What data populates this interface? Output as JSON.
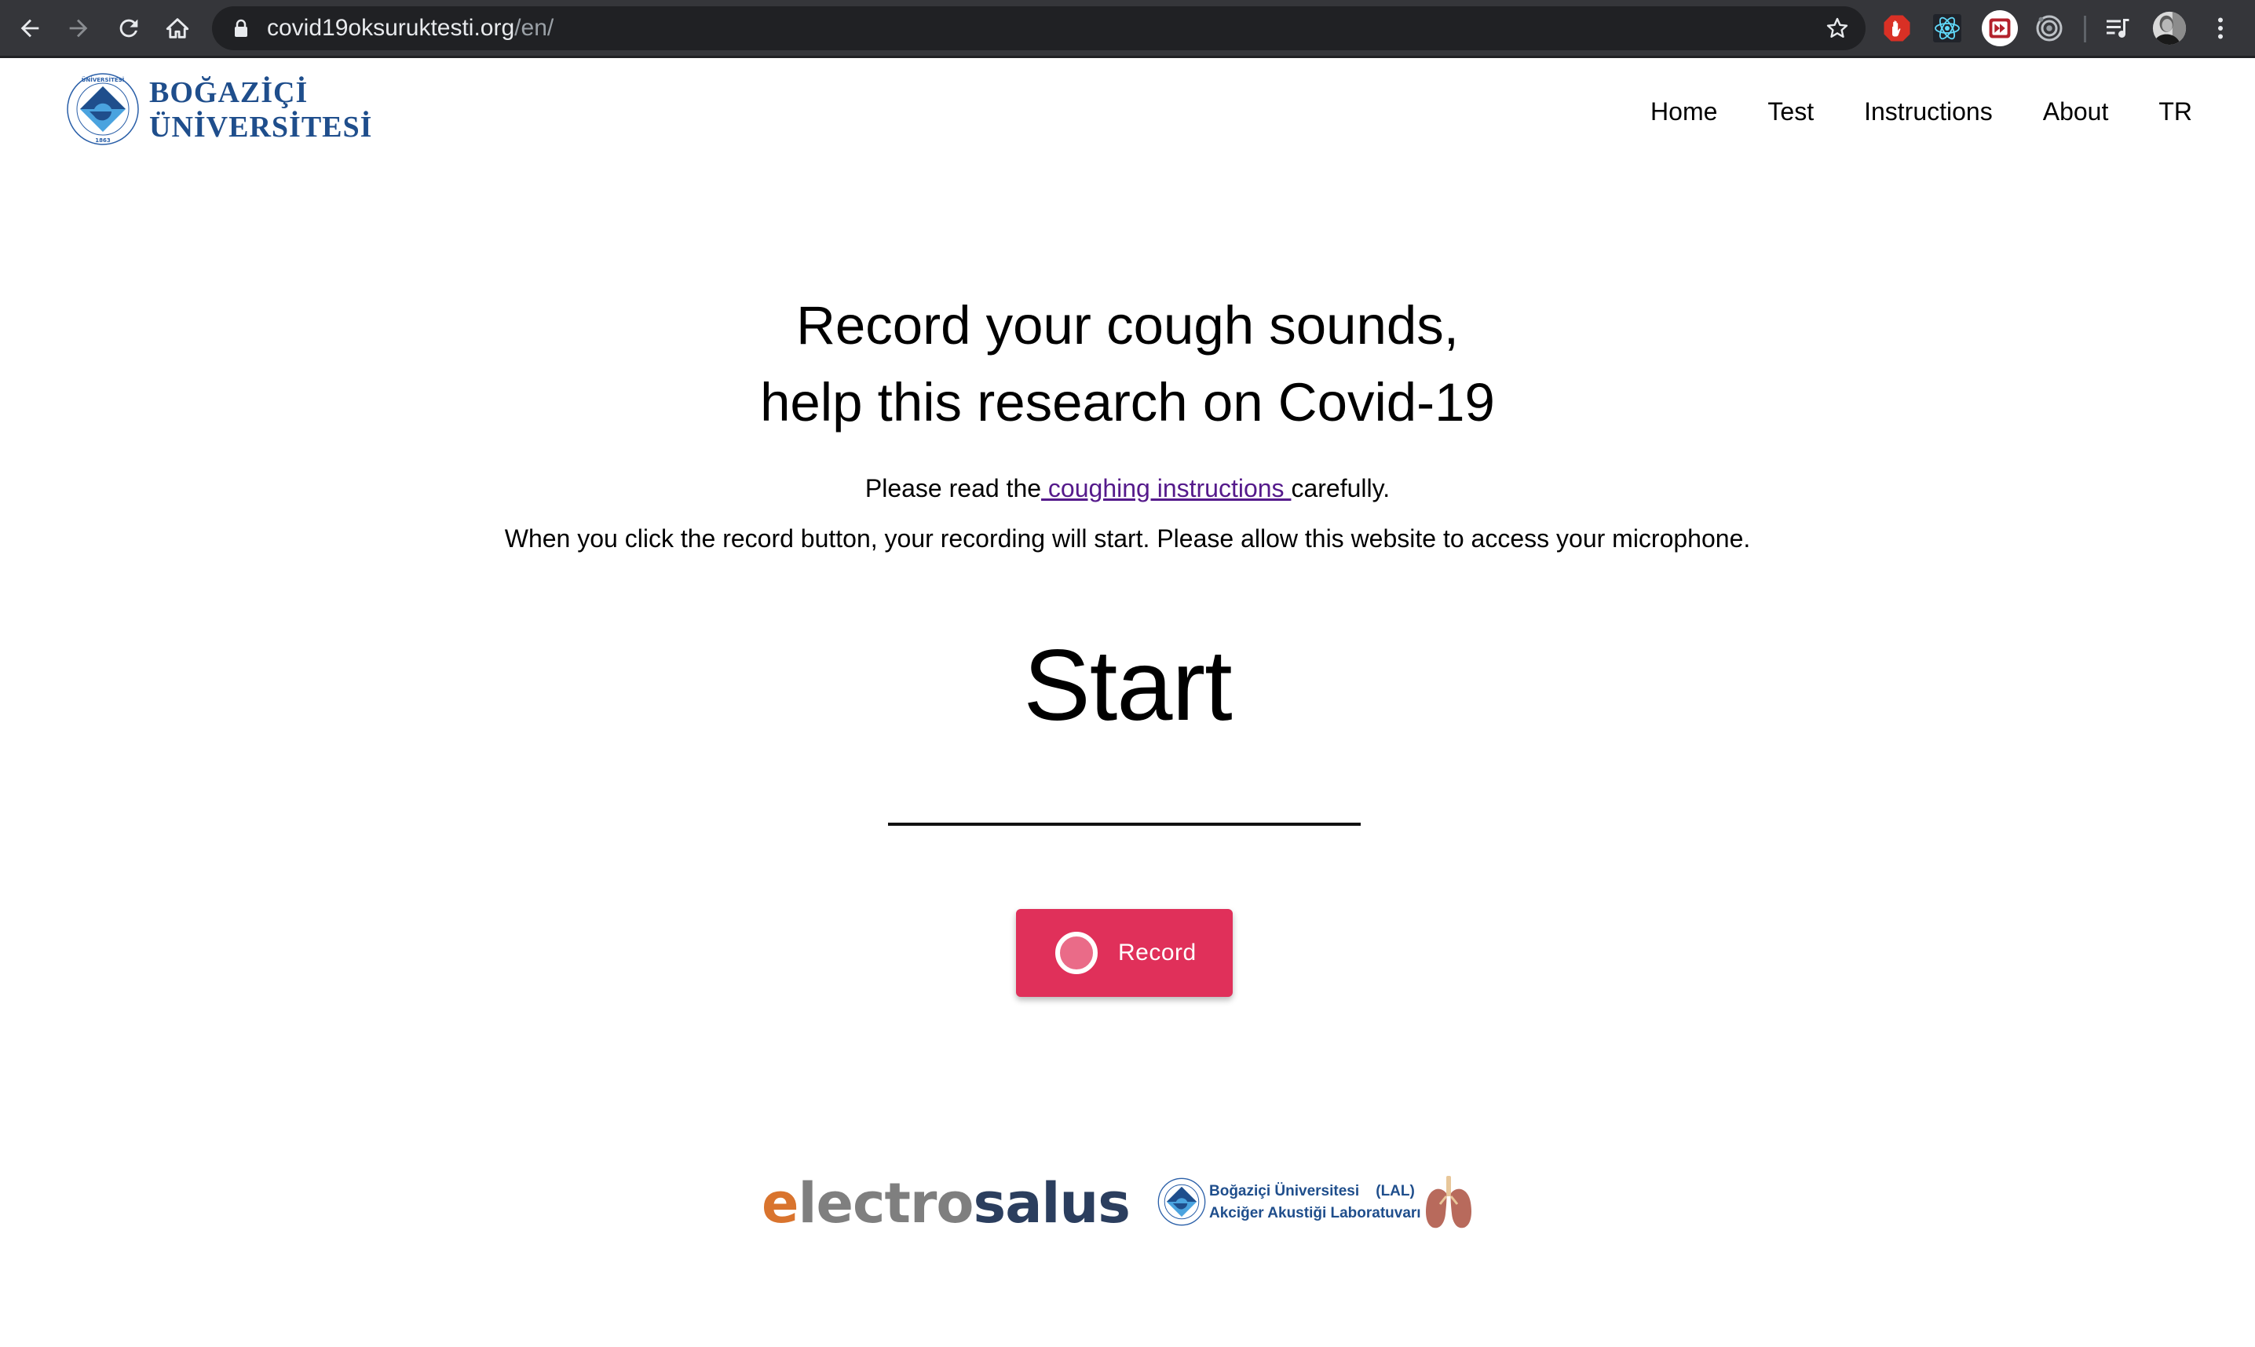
{
  "browser": {
    "url_host": "covid19oksuruktesti.org",
    "url_path": "/en/",
    "nav_buttons": [
      "back-icon",
      "forward-icon",
      "reload-icon",
      "home-icon"
    ],
    "extensions": [
      "adblock-icon",
      "react-devtools-icon",
      "video-speed-icon",
      "circle-target-icon",
      "media-playlist-icon"
    ],
    "colors": {
      "toolbar": "#35363a",
      "omnibox": "#202124"
    }
  },
  "site": {
    "logo": {
      "line1": "BOĞAZİÇİ",
      "line2": "ÜNİVERSİTESİ",
      "seal_top_text": "BOĞAZİÇİ ÜNİVERSİTESİ",
      "seal_year": "1863",
      "color": "#1f4e8c"
    },
    "nav": [
      {
        "label": "Home"
      },
      {
        "label": "Test"
      },
      {
        "label": "Instructions"
      },
      {
        "label": "About"
      },
      {
        "label": "TR"
      }
    ]
  },
  "main": {
    "headline_line1": "Record your cough sounds,",
    "headline_line2": "help this research on Covid-19",
    "p1_before": "Please read the",
    "p1_link": " coughing instructions ",
    "p1_after": "carefully.",
    "p2": "When you click the record button, your recording will start. Please allow this website to access your microphone.",
    "status": "Start",
    "record_button": {
      "label": "Record",
      "color": "#e0305a"
    }
  },
  "footer": {
    "electrosalus": {
      "part1": "e",
      "part2": "lectro",
      "part3": "salus"
    },
    "lal": {
      "line1_name": "Boğaziçi Üniversitesi",
      "line1_abbr": "(LAL)",
      "line2": "Akciğer Akustiği Laboratuvarı"
    }
  }
}
